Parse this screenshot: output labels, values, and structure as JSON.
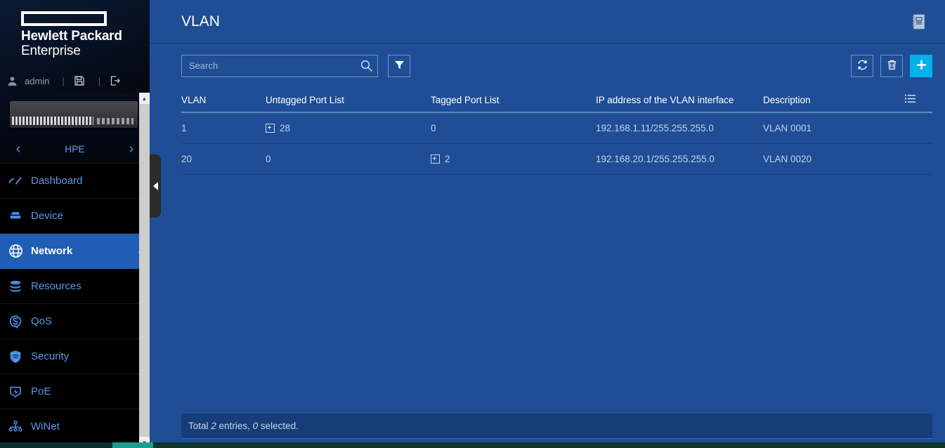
{
  "brand": {
    "logo_name": "hpe-logo-mark",
    "name": "Hewlett Packard",
    "sub": "Enterprise"
  },
  "userbar": {
    "user_icon": "user-icon",
    "username": "admin",
    "separator": "|",
    "save_icon": "save-disk-icon",
    "logout_icon": "logout-icon"
  },
  "device_panel": {
    "device_image": "network-switch-thumbnail",
    "prev_arrow": "‹",
    "next_arrow": "›",
    "label": "HPE"
  },
  "sidebar": {
    "items": [
      {
        "label": "Dashboard",
        "icon": "dashboard-icon",
        "caret": "",
        "active": false
      },
      {
        "label": "Device",
        "icon": "device-icon",
        "caret": "‹",
        "active": false
      },
      {
        "label": "Network",
        "icon": "globe-icon",
        "caret": "⌄",
        "active": true
      },
      {
        "label": "Resources",
        "icon": "database-icon",
        "caret": "‹",
        "active": false
      },
      {
        "label": "QoS",
        "icon": "qos-icon",
        "caret": "‹",
        "active": false
      },
      {
        "label": "Security",
        "icon": "shield-icon",
        "caret": "‹",
        "active": false
      },
      {
        "label": "PoE",
        "icon": "poe-icon",
        "caret": "‹",
        "active": false
      },
      {
        "label": "WiNet",
        "icon": "winet-icon",
        "caret": "",
        "active": false
      }
    ],
    "scrollbar_up": "▲",
    "scrollbar_down": "▼"
  },
  "header": {
    "title": "VLAN",
    "help_icon": "notebook-icon"
  },
  "toolbar": {
    "search_placeholder": "Search",
    "search_value": "",
    "search_icon": "search-icon",
    "filter_icon": "filter-icon",
    "refresh_icon": "refresh-icon",
    "delete_icon": "trash-icon",
    "add_icon": "plus-icon"
  },
  "table": {
    "columns": [
      "VLAN",
      "Untagged Port List",
      "Tagged Port List",
      "IP address of the VLAN interface",
      "Description"
    ],
    "column_menu_icon": "list-settings-icon",
    "rows": [
      {
        "vlan": "1",
        "untagged_count": "28",
        "untagged_expandable": true,
        "tagged_count": "0",
        "tagged_expandable": false,
        "ip": "192.168.1.11/255.255.255.0",
        "description": "VLAN 0001"
      },
      {
        "vlan": "20",
        "untagged_count": "0",
        "untagged_expandable": false,
        "tagged_count": "2",
        "tagged_expandable": true,
        "ip": "192.168.20.1/255.255.255.0",
        "description": "VLAN 0020"
      }
    ]
  },
  "footer": {
    "prefix": "Total ",
    "total": "2",
    "middle": " entries, ",
    "selected": "0",
    "suffix": " selected."
  },
  "colors": {
    "accent_blue": "#1f4e96",
    "active_nav": "#1f5eb4",
    "add_button": "#00b1ea",
    "sidebar_bg": "#000000",
    "nav_text": "#5a9ae8",
    "footer_bg": "#153d77"
  }
}
